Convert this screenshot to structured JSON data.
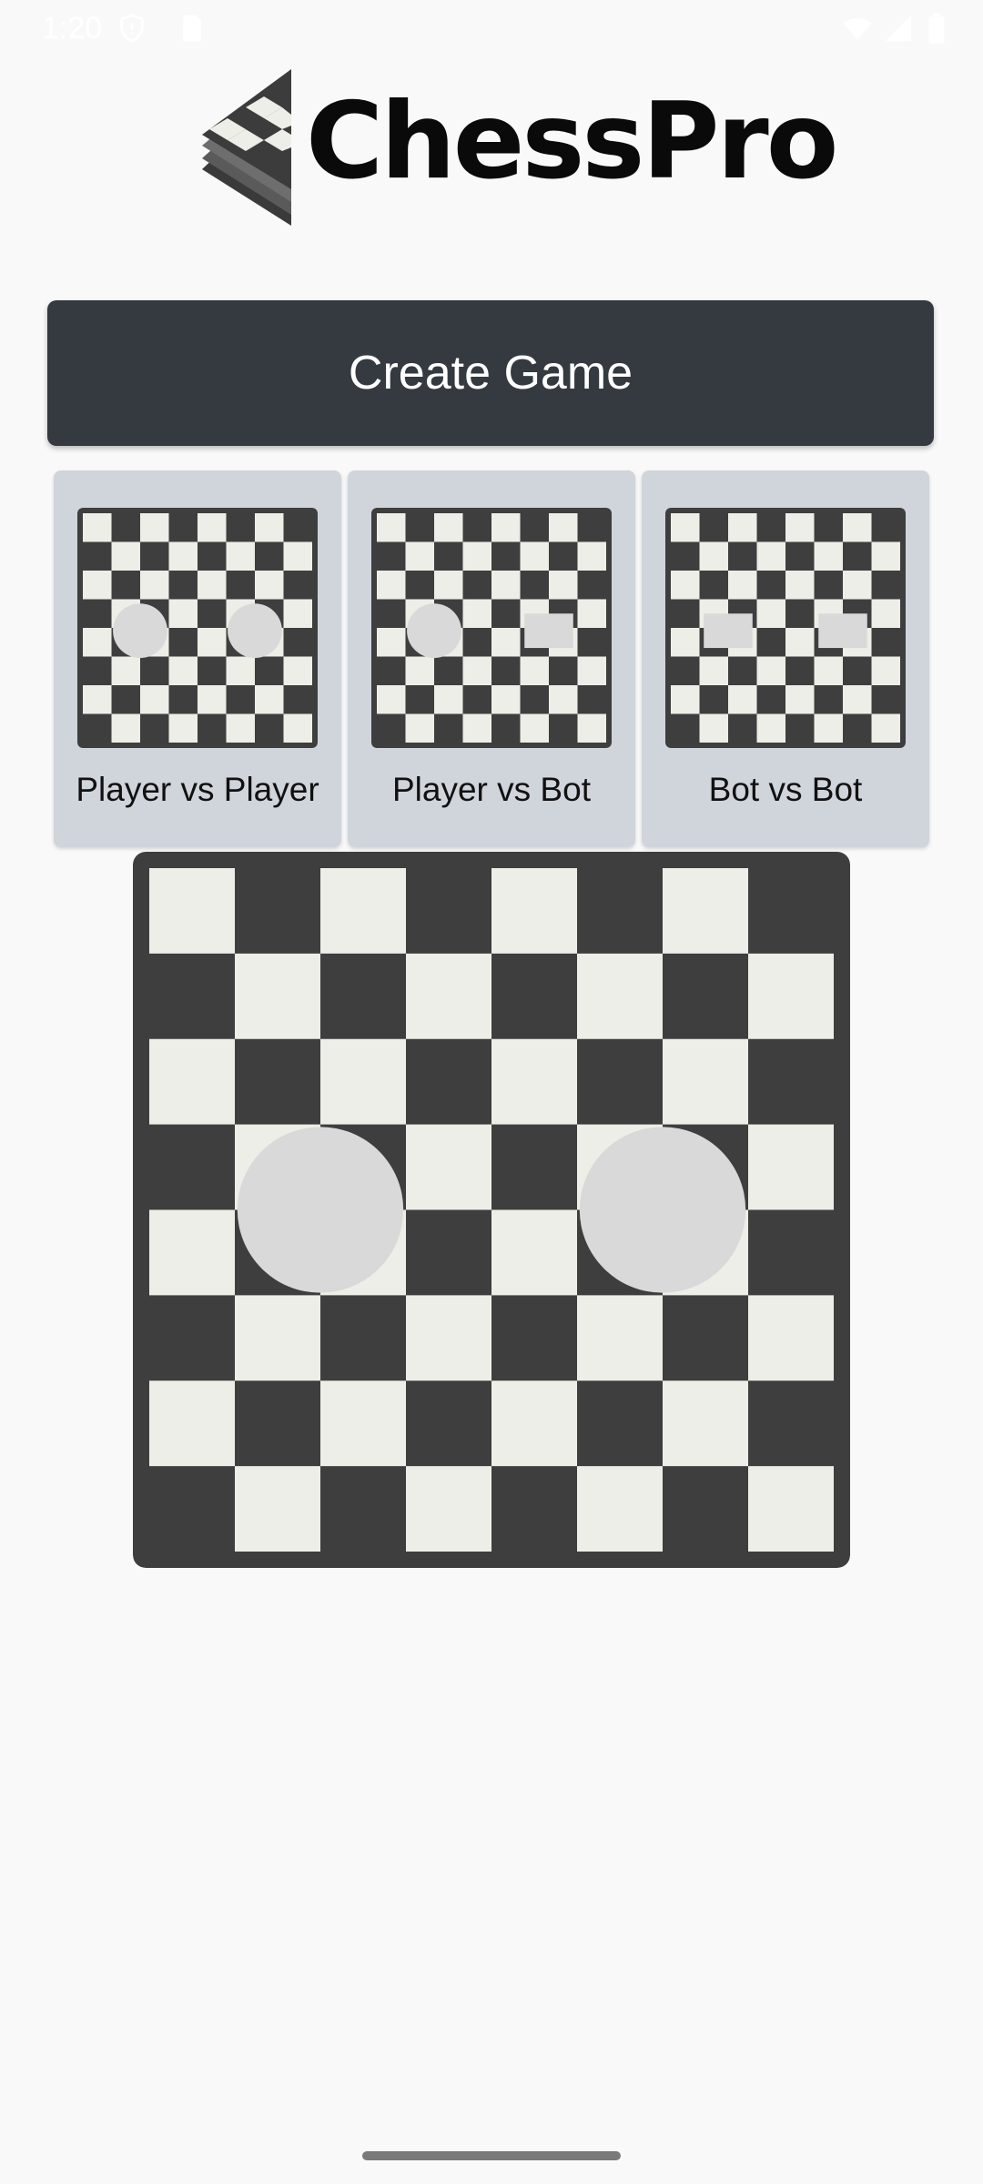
{
  "status_bar": {
    "time": "1:20",
    "icons": [
      "shield-icon",
      "sim-card-icon",
      "wifi-icon",
      "cellular-signal-icon",
      "battery-icon"
    ]
  },
  "logo": {
    "text": "ChessPro"
  },
  "create_game": {
    "label": "Create Game"
  },
  "modes": [
    {
      "label": "Player vs Player",
      "left_piece": "circle",
      "right_piece": "circle"
    },
    {
      "label": "Player vs Bot",
      "left_piece": "circle",
      "right_piece": "square"
    },
    {
      "label": "Bot vs Bot",
      "left_piece": "square",
      "right_piece": "square"
    }
  ],
  "colors": {
    "background": "#f9f9f9",
    "button": "#353a41",
    "card": "#d0d4db",
    "board_dark": "#3e3e3e",
    "board_light": "#eeeee8",
    "piece": "#d9d9d9"
  }
}
